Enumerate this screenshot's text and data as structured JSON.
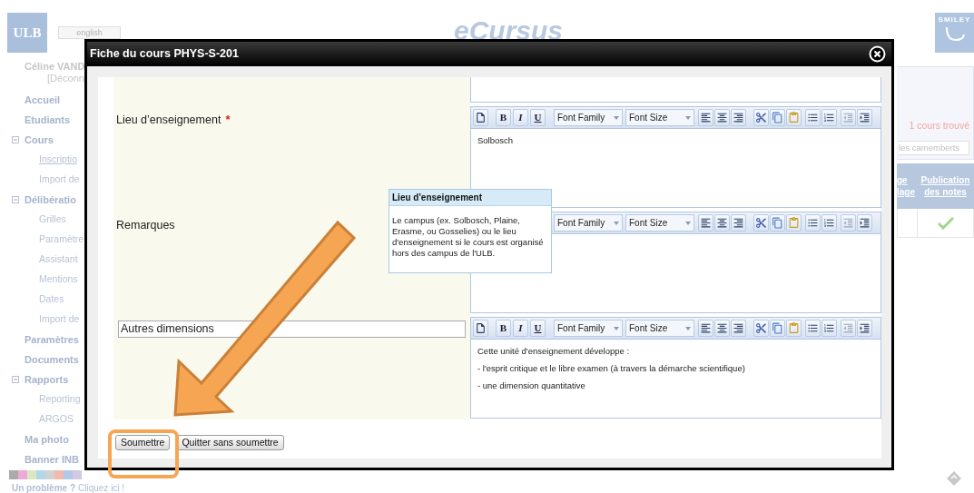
{
  "page": {
    "logo": "ULB",
    "language_button": "english",
    "app_logo": "eCursus",
    "partner_logo": "SMILEY",
    "user": {
      "name": "Céline VAND",
      "logout": "[Déconn"
    },
    "sidebar": {
      "items": [
        {
          "label": "Accueil",
          "selected": false
        },
        {
          "label": "Etudiants",
          "selected": false
        },
        {
          "label": "Cours",
          "selected": false,
          "expanded": true,
          "children": [
            {
              "label": "Inscriptio",
              "selected": true
            },
            {
              "label": "Import de",
              "selected": false
            }
          ]
        },
        {
          "label": "Délibératio",
          "selected": false,
          "expanded": true,
          "children": [
            {
              "label": "Grilles",
              "selected": false
            },
            {
              "label": "Paramètre",
              "selected": false
            },
            {
              "label": "Assistant",
              "selected": false
            },
            {
              "label": "Mentions",
              "selected": false
            },
            {
              "label": "Dates",
              "selected": false
            },
            {
              "label": "Import de",
              "selected": false
            }
          ]
        },
        {
          "label": "Paramètres",
          "selected": false
        },
        {
          "label": "Documents",
          "selected": false
        },
        {
          "label": "Rapports",
          "selected": false,
          "expanded": true,
          "children": [
            {
              "label": "Reporting",
              "selected": false
            },
            {
              "label": "ARGOS",
              "selected": false
            }
          ]
        },
        {
          "label": "Ma photo",
          "selected": false
        },
        {
          "label": "Banner INB",
          "selected": false
        }
      ]
    },
    "help": {
      "text": "Un problème ?",
      "link": "Cliquez ici !"
    },
    "results": {
      "count": "1 cours trouvé",
      "button": "les camemberts",
      "table": {
        "columns": [
          {
            "lines": [
              "ge",
              "lage"
            ]
          },
          {
            "lines": [
              "Publication",
              "des notes"
            ]
          }
        ],
        "rows": [
          {
            "published": true
          }
        ]
      }
    }
  },
  "dialog": {
    "title": "Fiche du cours PHYS-S-201",
    "fields": [
      {
        "kind": "partial"
      },
      {
        "kind": "label",
        "label": "Lieu d’enseignement",
        "required_mark": "*",
        "editor": {
          "toolbar": {
            "format_buttons": [
              "B",
              "I",
              "U"
            ],
            "selects": [
              "Font Family",
              "Font Size"
            ]
          },
          "paragraphs": [
            "Solbosch"
          ]
        }
      },
      {
        "kind": "label",
        "label": "Remarques",
        "editor": {
          "toolbar": {
            "selects": [
              "Font Family",
              "Font Size"
            ]
          }
        }
      },
      {
        "kind": "input",
        "value": "Autres dimensions",
        "editor": {
          "toolbar": {
            "format_buttons": [
              "B",
              "I",
              "U"
            ],
            "selects": [
              "Font Family",
              "Font Size"
            ]
          },
          "paragraphs": [
            "Cette unité d'enseignement développe :",
            "- l'esprit critique et le libre examen (à travers la démarche scientifique)",
            "- une dimension quantitative"
          ]
        }
      }
    ],
    "tooltip": {
      "title": "Lieu d'enseignement",
      "text": "Le campus (ex. Solbosch, Plaine, Erasme, ou Gosselies) ou le lieu d'enseignement si le cours est organisé hors des campus de l'ULB."
    },
    "buttons": [
      {
        "label": "Soumettre"
      },
      {
        "label": "Quitter sans soumettre"
      }
    ]
  }
}
